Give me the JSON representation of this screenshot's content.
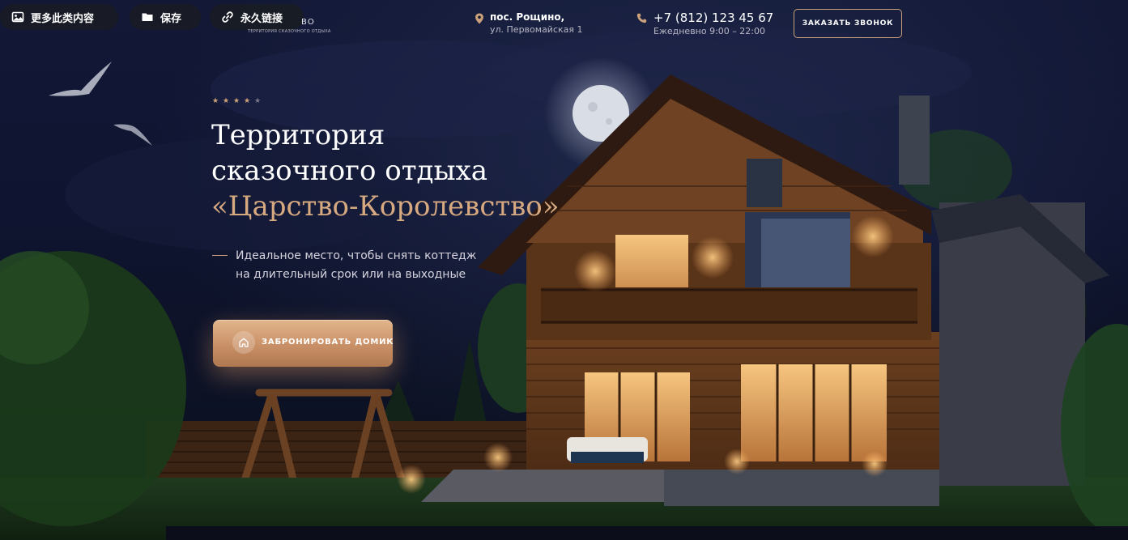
{
  "overlay_toolbar": {
    "more_label": "更多此类内容",
    "save_label": "保存",
    "permalink_label": "永久链接"
  },
  "header": {
    "logo_name": "ВО",
    "logo_tagline": "ТЕРРИТОРИЯ СКАЗОЧНОГО ОТДЫХА",
    "address_line1": "пос. Рощино,",
    "address_line2": "ул. Первомайская 1",
    "phone": "+7 (812) 123 45 67",
    "hours": "Ежедневно 9:00 – 22:00",
    "callback_label": "ЗАКАЗАТЬ ЗВОНОК"
  },
  "hero": {
    "rating": {
      "value": 4,
      "max": 5
    },
    "title_line1": "Территория",
    "title_line2": "сказочного отдыха",
    "title_line3": "«Царство-Королевство»",
    "lead_line1": "Идеальное место, чтобы снять коттедж",
    "lead_line2": "на длительный срок или на выходные",
    "book_label": "ЗАБРОНИРОВАТЬ ДОМИК"
  },
  "colors": {
    "accent": "#d7a980",
    "button": "#c99067",
    "background": "#0f1430"
  },
  "icons": {
    "more": "image-icon",
    "save": "folder-icon",
    "permalink": "link-icon",
    "address": "map-pin-icon",
    "phone": "phone-icon",
    "book": "home-icon",
    "star": "star-icon"
  }
}
